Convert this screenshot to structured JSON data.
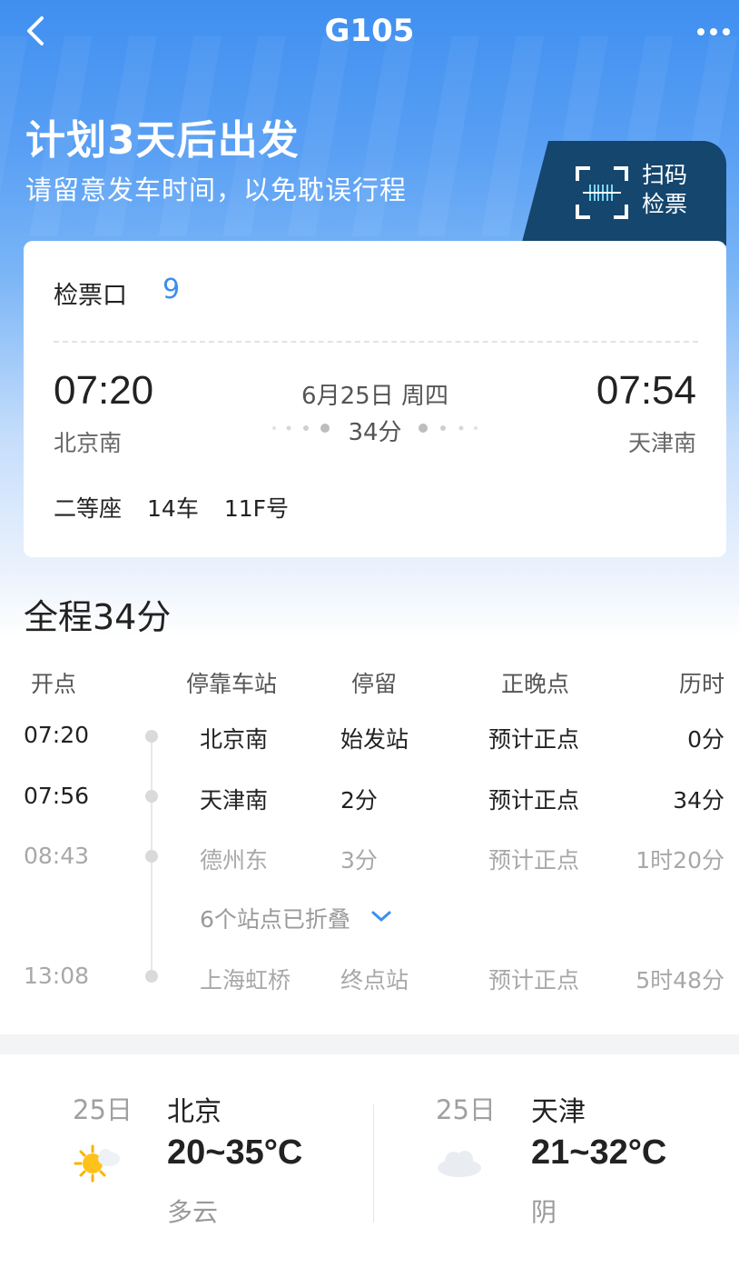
{
  "nav": {
    "title": "G105"
  },
  "plan": {
    "title": "计划3天后出发",
    "subtitle": "请留意发车时间，以免耽误行程"
  },
  "scan_button": {
    "line1": "扫码",
    "line2": "检票"
  },
  "ticket": {
    "gate_label": "检票口",
    "gate_number": "9",
    "departure_time": "07:20",
    "arrival_time": "07:54",
    "departure_station": "北京南",
    "arrival_station": "天津南",
    "date": "6月25日 周四",
    "duration": "34分",
    "seat_class": "二等座",
    "car": "14车",
    "seat": "11F号"
  },
  "journey": {
    "title": "全程34分",
    "headers": {
      "time": "开点",
      "station": "停靠车站",
      "stop": "停留",
      "punctuality": "正晚点",
      "elapsed": "历时"
    },
    "stops": [
      {
        "time": "07:20",
        "station": "北京南",
        "stop": "始发站",
        "punctuality": "预计正点",
        "elapsed": "0分"
      },
      {
        "time": "07:56",
        "station": "天津南",
        "stop": "2分",
        "punctuality": "预计正点",
        "elapsed": "34分"
      },
      {
        "time": "08:43",
        "station": "德州东",
        "stop": "3分",
        "punctuality": "预计正点",
        "elapsed": "1时20分"
      },
      {
        "time": "13:08",
        "station": "上海虹桥",
        "stop": "终点站",
        "punctuality": "预计正点",
        "elapsed": "5时48分"
      }
    ],
    "collapsed_text": "6个站点已折叠"
  },
  "weather": [
    {
      "date": "25日",
      "city": "北京",
      "temp": "20~35°C",
      "desc": "多云",
      "icon": "partly-cloudy-sun-icon"
    },
    {
      "date": "25日",
      "city": "天津",
      "temp": "21~32°C",
      "desc": "阴",
      "icon": "cloud-icon"
    }
  ],
  "colors": {
    "header_blue": "#3f8ff0",
    "accent_blue": "#3b8ef0",
    "scan_button_bg": "#14466e"
  }
}
